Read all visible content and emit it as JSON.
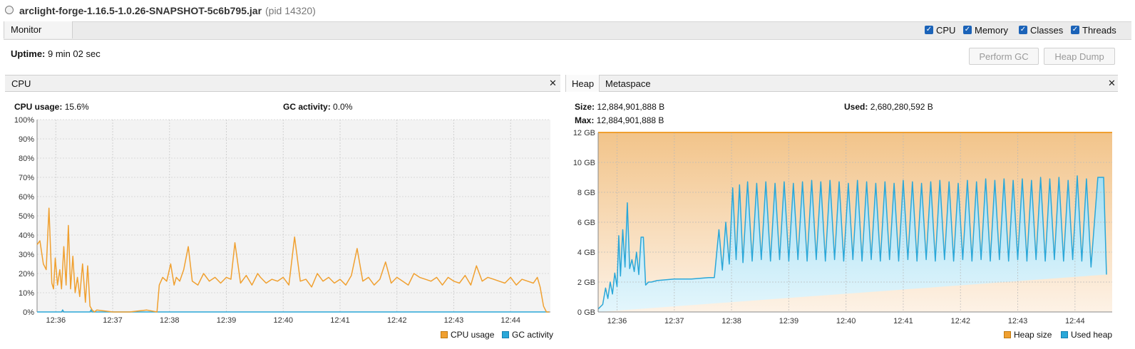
{
  "window": {
    "title": "arclight-forge-1.16.5-1.0.26-SNAPSHOT-5c6b795.jar",
    "pid_label": "(pid 14320)"
  },
  "monitor": {
    "tab_label": "Monitor",
    "checkboxes": [
      {
        "label": "CPU",
        "checked": true
      },
      {
        "label": "Memory",
        "checked": true
      },
      {
        "label": "Classes",
        "checked": true
      },
      {
        "label": "Threads",
        "checked": true
      }
    ],
    "uptime_label": "Uptime:",
    "uptime_value": "9 min 02 sec",
    "perform_gc_label": "Perform GC",
    "heap_dump_label": "Heap Dump"
  },
  "cpu_panel": {
    "tab_label": "CPU",
    "close_glyph": "✕",
    "cpu_usage_label": "CPU usage:",
    "cpu_usage_value": "15.6%",
    "gc_activity_label": "GC activity:",
    "gc_activity_value": "0.0%",
    "legend": [
      {
        "label": "CPU usage",
        "color": "#f0a030"
      },
      {
        "label": "GC activity",
        "color": "#2aa7d8"
      }
    ]
  },
  "heap_panel": {
    "tabs": [
      {
        "label": "Heap",
        "active": true
      },
      {
        "label": "Metaspace",
        "active": false
      }
    ],
    "close_glyph": "✕",
    "size_label": "Size:",
    "size_value": "12,884,901,888 B",
    "used_label": "Used:",
    "used_value": "2,680,280,592 B",
    "max_label": "Max:",
    "max_value": "12,884,901,888 B",
    "legend": [
      {
        "label": "Heap size",
        "color": "#f0a030"
      },
      {
        "label": "Used heap",
        "color": "#2aa7d8"
      }
    ]
  },
  "colors": {
    "accent_blue": "#1b63b8",
    "cpu_line": "#f0a030",
    "gc_line": "#2aa7d8",
    "heap_size": "#f0a030",
    "used_heap": "#2aa7d8"
  },
  "chart_data": [
    {
      "type": "line",
      "title": "CPU",
      "x_ticks": [
        "12:36",
        "12:37",
        "12:38",
        "12:39",
        "12:40",
        "12:41",
        "12:42",
        "12:43",
        "12:44"
      ],
      "y_ticks": [
        "0%",
        "10%",
        "20%",
        "30%",
        "40%",
        "50%",
        "60%",
        "70%",
        "80%",
        "90%",
        "100%"
      ],
      "ylim": [
        0,
        100
      ],
      "xlim_minutes": [
        -0.33,
        8.7
      ],
      "grid": true,
      "legend_position": "bottom-right",
      "series": [
        {
          "name": "CPU usage",
          "x_minutes": [
            -0.33,
            -0.28,
            -0.22,
            -0.17,
            -0.12,
            -0.07,
            -0.04,
            -0.01,
            0.03,
            0.07,
            0.1,
            0.14,
            0.18,
            0.22,
            0.26,
            0.3,
            0.34,
            0.38,
            0.42,
            0.47,
            0.52,
            0.56,
            0.6,
            0.64,
            0.68,
            0.72,
            1.0,
            1.3,
            1.6,
            1.78,
            1.82,
            1.88,
            1.95,
            2.02,
            2.08,
            2.12,
            2.18,
            2.25,
            2.33,
            2.4,
            2.5,
            2.6,
            2.7,
            2.8,
            2.9,
            3.0,
            3.08,
            3.15,
            3.25,
            3.35,
            3.45,
            3.55,
            3.6,
            3.7,
            3.8,
            3.9,
            4.0,
            4.1,
            4.2,
            4.3,
            4.4,
            4.5,
            4.6,
            4.7,
            4.8,
            4.9,
            5.0,
            5.1,
            5.2,
            5.3,
            5.4,
            5.5,
            5.6,
            5.7,
            5.8,
            5.9,
            6.0,
            6.1,
            6.2,
            6.3,
            6.4,
            6.5,
            6.6,
            6.7,
            6.8,
            6.9,
            7.0,
            7.1,
            7.2,
            7.3,
            7.4,
            7.5,
            7.6,
            7.7,
            7.8,
            7.9,
            8.0,
            8.1,
            8.2,
            8.3,
            8.4,
            8.47,
            8.52,
            8.58,
            8.63,
            8.68
          ],
          "values": [
            35,
            37,
            25,
            22,
            54,
            15,
            12,
            28,
            14,
            22,
            12,
            34,
            14,
            45,
            12,
            29,
            10,
            18,
            8,
            25,
            5,
            24,
            3,
            1,
            0,
            1,
            0,
            0,
            1,
            0,
            14,
            18,
            16,
            25,
            14,
            18,
            16,
            22,
            34,
            16,
            14,
            20,
            16,
            18,
            15,
            18,
            17,
            36,
            15,
            19,
            14,
            20,
            18,
            15,
            17,
            16,
            18,
            14,
            39,
            16,
            17,
            13,
            20,
            16,
            18,
            15,
            17,
            14,
            19,
            33,
            16,
            18,
            14,
            17,
            26,
            15,
            18,
            16,
            14,
            20,
            18,
            17,
            16,
            18,
            14,
            18,
            16,
            15,
            19,
            14,
            24,
            16,
            18,
            17,
            16,
            15,
            18,
            14,
            17,
            16,
            15,
            18,
            13,
            3,
            0,
            0,
            20
          ]
        },
        {
          "name": "GC activity",
          "x_minutes": [
            -0.33,
            0.1,
            0.12,
            0.14,
            0.6,
            0.62,
            0.64,
            8.68
          ],
          "values": [
            0,
            0,
            1,
            0,
            0,
            1,
            0,
            0
          ]
        }
      ]
    },
    {
      "type": "area",
      "title": "Heap",
      "x_ticks": [
        "12:36",
        "12:37",
        "12:38",
        "12:39",
        "12:40",
        "12:41",
        "12:42",
        "12:43",
        "12:44"
      ],
      "y_ticks": [
        "0 GB",
        "2 GB",
        "4 GB",
        "6 GB",
        "8 GB",
        "10 GB",
        "12 GB"
      ],
      "ylim_gb": [
        0,
        12
      ],
      "xlim_minutes": [
        -0.33,
        8.65
      ],
      "grid": true,
      "legend_position": "bottom-right",
      "series": [
        {
          "name": "Heap size",
          "x_minutes": [
            -0.33,
            8.65
          ],
          "values_gb": [
            12,
            12
          ]
        },
        {
          "name": "Used heap",
          "x_minutes": [
            -0.33,
            -0.25,
            -0.2,
            -0.16,
            -0.12,
            -0.08,
            -0.04,
            0.0,
            0.03,
            0.06,
            0.1,
            0.14,
            0.18,
            0.22,
            0.26,
            0.3,
            0.34,
            0.38,
            0.42,
            0.46,
            0.5,
            0.55,
            0.58,
            0.6,
            0.7,
            1.0,
            1.3,
            1.6,
            1.7,
            1.78,
            1.84,
            1.9,
            1.96,
            2.02,
            2.08,
            2.14,
            2.2,
            2.28,
            2.36,
            2.44,
            2.52,
            2.6,
            2.68,
            2.76,
            2.84,
            2.92,
            3.0,
            3.08,
            3.16,
            3.24,
            3.32,
            3.4,
            3.48,
            3.56,
            3.64,
            3.72,
            3.8,
            3.88,
            3.96,
            4.04,
            4.12,
            4.2,
            4.28,
            4.36,
            4.44,
            4.52,
            4.6,
            4.68,
            4.76,
            4.84,
            4.92,
            5.0,
            5.08,
            5.16,
            5.24,
            5.32,
            5.4,
            5.48,
            5.56,
            5.64,
            5.72,
            5.8,
            5.88,
            5.96,
            6.04,
            6.12,
            6.2,
            6.28,
            6.36,
            6.44,
            6.52,
            6.6,
            6.68,
            6.76,
            6.84,
            6.92,
            7.0,
            7.08,
            7.16,
            7.24,
            7.32,
            7.4,
            7.48,
            7.56,
            7.64,
            7.72,
            7.8,
            7.88,
            7.96,
            8.04,
            8.12,
            8.2,
            8.28,
            8.35,
            8.4,
            8.45,
            8.5,
            8.55,
            8.6,
            8.65
          ],
          "values_gb": [
            0.2,
            0.5,
            1.6,
            0.9,
            2.0,
            1.2,
            2.6,
            1.7,
            5.1,
            2.4,
            5.5,
            3.0,
            7.3,
            2.9,
            3.5,
            2.7,
            4.0,
            2.5,
            5.0,
            5.0,
            1.8,
            2.0,
            2.0,
            2.0,
            2.1,
            2.2,
            2.2,
            2.3,
            2.3,
            5.5,
            2.8,
            6.0,
            3.2,
            8.3,
            3.5,
            8.5,
            3.3,
            8.7,
            3.4,
            8.6,
            3.5,
            8.7,
            3.4,
            8.6,
            3.5,
            8.7,
            3.4,
            8.6,
            3.5,
            8.7,
            3.4,
            8.8,
            3.5,
            8.7,
            3.4,
            8.8,
            3.5,
            8.7,
            3.4,
            8.6,
            3.5,
            8.8,
            3.4,
            8.7,
            3.5,
            8.6,
            3.4,
            8.7,
            3.5,
            8.6,
            3.4,
            8.8,
            3.5,
            8.7,
            3.4,
            8.6,
            3.5,
            8.7,
            3.4,
            8.8,
            3.5,
            8.7,
            3.4,
            8.6,
            3.5,
            8.8,
            3.4,
            8.7,
            3.5,
            8.9,
            3.4,
            8.8,
            3.5,
            8.9,
            3.4,
            8.8,
            3.5,
            8.9,
            3.4,
            8.8,
            3.5,
            9.0,
            3.4,
            8.9,
            3.5,
            9.0,
            3.4,
            8.8,
            3.5,
            9.1,
            3.4,
            8.9,
            3.0,
            6.5,
            9.0,
            9.0,
            9.0,
            2.5
          ]
        }
      ]
    }
  ]
}
